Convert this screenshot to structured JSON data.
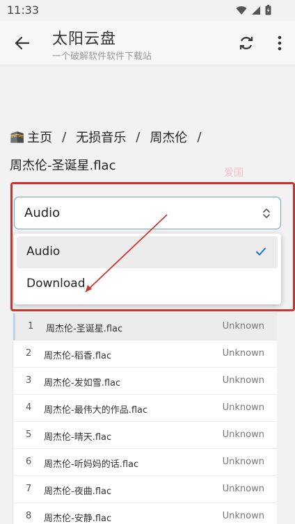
{
  "status_bar": {
    "time": "11:33"
  },
  "app_bar": {
    "title": "太阳云盘",
    "subtitle": "一个破解软件软件下载站",
    "back_icon": "arrow-left-icon",
    "refresh_icon": "refresh-icon",
    "more_icon": "more-vertical-icon"
  },
  "breadcrumb": {
    "home_label": "主页",
    "items": [
      "无损音乐",
      "周杰伦"
    ],
    "separator": "/"
  },
  "current_file": "周杰伦-圣诞星.flac",
  "watermark": "爱国",
  "select": {
    "value": "Audio",
    "options": [
      {
        "label": "Audio",
        "selected": true
      },
      {
        "label": "Download",
        "selected": false
      }
    ]
  },
  "files": [
    {
      "num": "1",
      "name": "周杰伦-圣诞星.flac",
      "size": "Unknown"
    },
    {
      "num": "2",
      "name": "周杰伦-稻香.flac",
      "size": "Unknown"
    },
    {
      "num": "3",
      "name": "周杰伦-发如雪.flac",
      "size": "Unknown"
    },
    {
      "num": "4",
      "name": "周杰伦-最伟大的作品.flac",
      "size": "Unknown"
    },
    {
      "num": "5",
      "name": "周杰伦-晴天.flac",
      "size": "Unknown"
    },
    {
      "num": "6",
      "name": "周杰伦-听妈妈的话.flac",
      "size": "Unknown"
    },
    {
      "num": "7",
      "name": "周杰伦-夜曲.flac",
      "size": "Unknown"
    },
    {
      "num": "8",
      "name": "周杰伦-安静.flac",
      "size": "Unknown"
    }
  ],
  "colors": {
    "accent": "#6aa3db",
    "annotation": "#c9352e",
    "check": "#1e6fd0"
  }
}
